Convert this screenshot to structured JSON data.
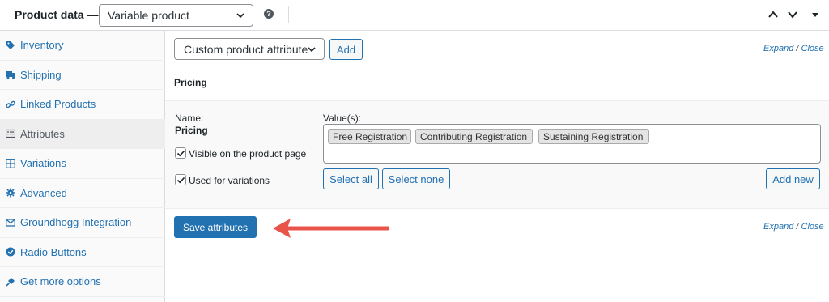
{
  "header": {
    "title": "Product data —",
    "product_type": "Variable product",
    "help_icon": "?"
  },
  "sidebar": {
    "items": [
      {
        "label": "Inventory",
        "icon": "tag-icon"
      },
      {
        "label": "Shipping",
        "icon": "truck-icon"
      },
      {
        "label": "Linked Products",
        "icon": "link-icon"
      },
      {
        "label": "Attributes",
        "icon": "list-icon",
        "active": true
      },
      {
        "label": "Variations",
        "icon": "grid-icon"
      },
      {
        "label": "Advanced",
        "icon": "gear-icon"
      },
      {
        "label": "Groundhogg Integration",
        "icon": "mail-icon"
      },
      {
        "label": "Radio Buttons",
        "icon": "check-circle-icon"
      },
      {
        "label": "Get more options",
        "icon": "plugin-icon"
      }
    ]
  },
  "toolbar": {
    "attribute_select": "Custom product attribute",
    "add_label": "Add",
    "expand": "Expand",
    "separator": "/",
    "close": "Close"
  },
  "attribute": {
    "title": "Pricing",
    "name_label": "Name:",
    "name_value": "Pricing",
    "values_label": "Value(s):",
    "values": [
      "Free Registration",
      "Contributing Registration",
      "Sustaining Registration"
    ],
    "visible_label": "Visible on the product page",
    "visible_checked": true,
    "variations_label": "Used for variations",
    "variations_checked": true,
    "select_all_label": "Select all",
    "select_none_label": "Select none",
    "add_new_label": "Add new"
  },
  "footer": {
    "save_label": "Save attributes",
    "expand": "Expand",
    "separator": "/",
    "close": "Close"
  },
  "colors": {
    "accent": "#2271b1",
    "annotation_arrow": "#e8534a"
  }
}
